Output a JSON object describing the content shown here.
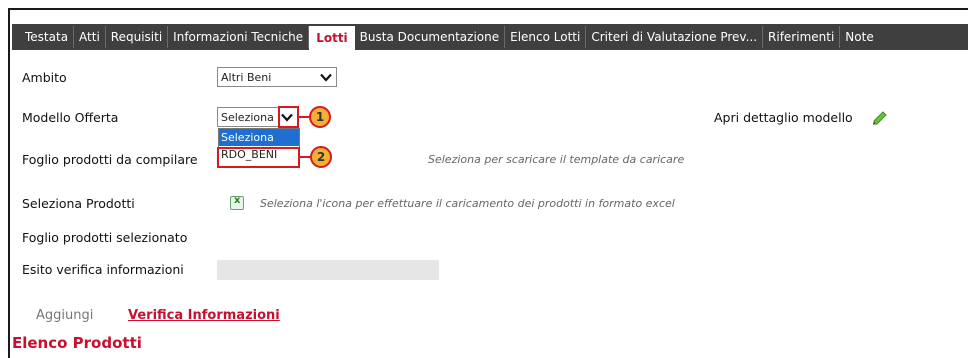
{
  "tabs": [
    {
      "label": "Testata",
      "active": false
    },
    {
      "label": "Atti",
      "active": false
    },
    {
      "label": "Requisiti",
      "active": false
    },
    {
      "label": "Informazioni Tecniche",
      "active": false
    },
    {
      "label": "Lotti",
      "active": true
    },
    {
      "label": "Busta Documentazione",
      "active": false
    },
    {
      "label": "Elenco Lotti",
      "active": false
    },
    {
      "label": "Criteri di Valutazione Prev...",
      "active": false
    },
    {
      "label": "Riferimenti",
      "active": false
    },
    {
      "label": "Note",
      "active": false
    }
  ],
  "form": {
    "ambito": {
      "label": "Ambito",
      "value": "Altri Beni"
    },
    "modello": {
      "label": "Modello Offerta",
      "value": "Seleziona",
      "options": [
        "Seleziona",
        "RDO_BENI"
      ]
    },
    "apri_dettaglio": "Apri dettaglio modello",
    "foglio_compilare": {
      "label": "Foglio prodotti da compilare",
      "hint": "Seleziona per scaricare il template da caricare"
    },
    "seleziona_prodotti": {
      "label": "Seleziona Prodotti",
      "hint": "Seleziona l'icona per effettuare il caricamento dei prodotti in formato excel"
    },
    "foglio_selezionato": {
      "label": "Foglio prodotti selezionato"
    },
    "esito": {
      "label": "Esito verifica informazioni",
      "value": ""
    }
  },
  "actions": {
    "aggiungi": "Aggiungi",
    "verifica": "Verifica Informazioni"
  },
  "section_title": "Elenco Prodotti",
  "callouts": [
    "1",
    "2"
  ],
  "colors": {
    "accent": "#c8102e",
    "tabbar": "#3f3f3f",
    "callout_fill": "#f2b134",
    "callout_border": "#d71920",
    "selected_option": "#1e6fd0"
  },
  "icons": {
    "edit": "pencil-icon",
    "excel": "excel-file-icon",
    "dropdown": "chevron-down-icon"
  }
}
